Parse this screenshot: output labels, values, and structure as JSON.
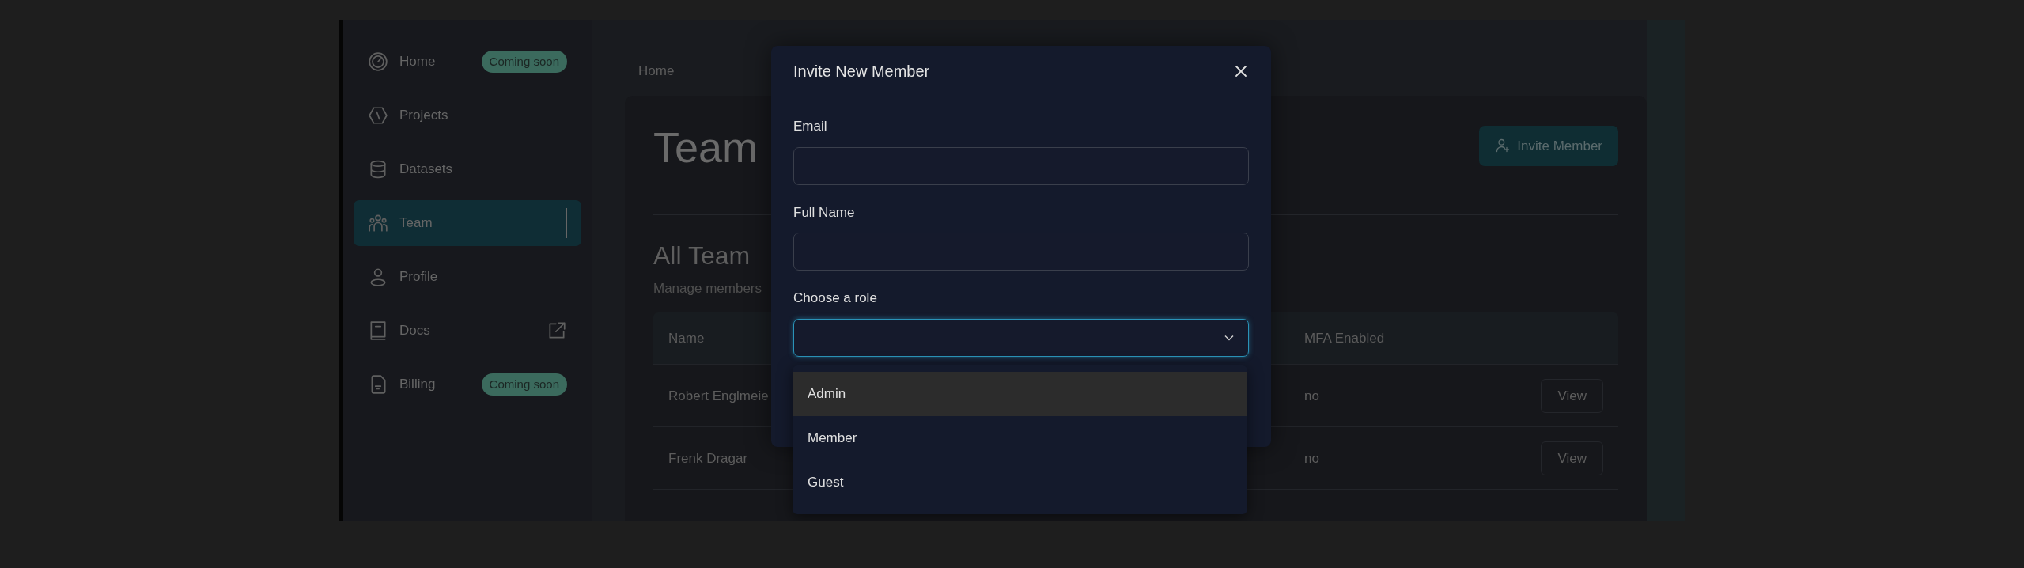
{
  "sidebar": {
    "items": [
      {
        "label": "Home",
        "badge": "Coming soon",
        "external": false,
        "selected": false
      },
      {
        "label": "Projects",
        "external": false,
        "selected": false
      },
      {
        "label": "Datasets",
        "external": false,
        "selected": false
      },
      {
        "label": "Team",
        "external": false,
        "selected": true
      },
      {
        "label": "Profile",
        "external": false,
        "selected": false
      },
      {
        "label": "Docs",
        "external": true,
        "selected": false
      },
      {
        "label": "Billing",
        "badge": "Coming soon",
        "external": false,
        "selected": false
      }
    ]
  },
  "main": {
    "breadcrumb": "Home",
    "title": "Team",
    "invite_button": "Invite Member",
    "section_title": "All Team",
    "section_subtitle": "Manage members",
    "table": {
      "columns": [
        "Name",
        "MFA Enabled"
      ],
      "rows": [
        {
          "name": "Robert Englmeie",
          "mfa": "no",
          "action": "View"
        },
        {
          "name": "Frenk Dragar",
          "mfa": "no",
          "action": "View"
        }
      ]
    }
  },
  "modal": {
    "title": "Invite New Member",
    "fields": [
      {
        "label": "Email",
        "kind": "text",
        "focused": false
      },
      {
        "label": "Full Name",
        "kind": "text",
        "focused": false
      },
      {
        "label": "Choose a role",
        "kind": "select",
        "focused": true
      }
    ],
    "options": [
      {
        "label": "Admin",
        "selected": true
      },
      {
        "label": "Member",
        "selected": false
      },
      {
        "label": "Guest",
        "selected": false
      }
    ]
  }
}
